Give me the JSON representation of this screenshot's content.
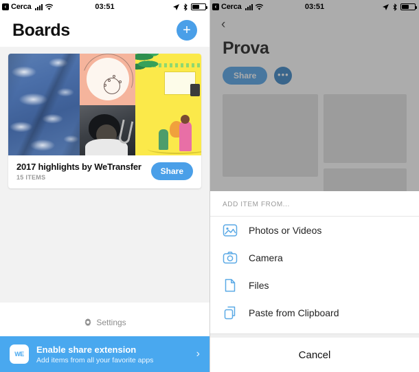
{
  "status_bar": {
    "back_glyph": "‹",
    "carrier": "Cerca",
    "time": "03:51",
    "location_icon": "➤",
    "bluetooth_icon": "✲"
  },
  "left_screen": {
    "title": "Boards",
    "add_button_label": "+",
    "board": {
      "title": "2017 highlights by WeTransfer",
      "subtitle": "15 ITEMS",
      "share_label": "Share"
    },
    "settings": {
      "label": "Settings",
      "icon": "gear-icon"
    },
    "promo": {
      "logo_text": "WE",
      "title": "Enable share extension",
      "subtitle": "Add items from all your favorite apps",
      "chevron": "›"
    }
  },
  "right_screen": {
    "back_chevron": "‹",
    "title": "Prova",
    "share_label": "Share",
    "more_label": "•••",
    "sheet": {
      "header": "ADD ITEM FROM...",
      "items": [
        {
          "label": "Photos or Videos",
          "icon": "photo-icon"
        },
        {
          "label": "Camera",
          "icon": "camera-icon"
        },
        {
          "label": "Files",
          "icon": "file-icon"
        },
        {
          "label": "Paste from Clipboard",
          "icon": "clipboard-icon"
        }
      ],
      "cancel_label": "Cancel"
    }
  },
  "colors": {
    "accent_blue": "#4a9fe8",
    "promo_blue": "#49a8ef",
    "icon_blue": "#5aa9e6",
    "page_background": "#f2f2f2",
    "muted_text": "#9a9a9a"
  }
}
